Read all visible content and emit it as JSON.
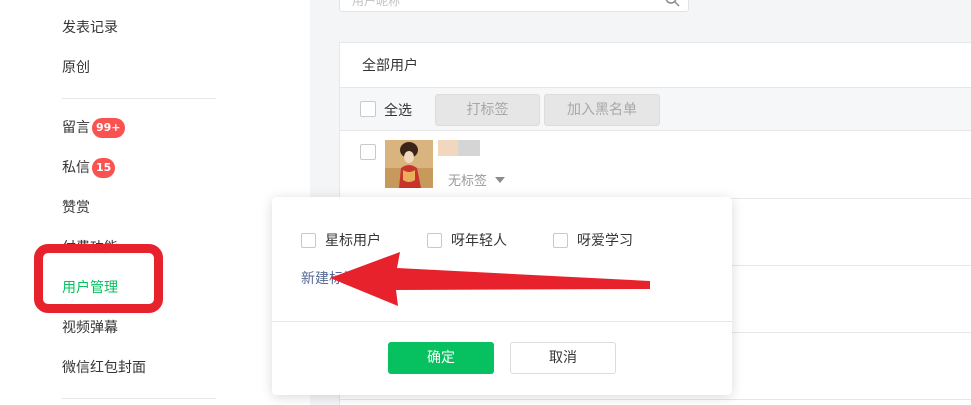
{
  "sidebar": {
    "items": [
      {
        "label": "发表记录"
      },
      {
        "label": "原创"
      },
      {
        "label": "留言",
        "badge": "99+"
      },
      {
        "label": "私信",
        "badge": "15"
      },
      {
        "label": "赞赏"
      },
      {
        "label": "付费功能"
      },
      {
        "label": "用户管理"
      },
      {
        "label": "视频弹幕"
      },
      {
        "label": "微信红包封面"
      }
    ]
  },
  "search": {
    "placeholder": "用户昵称"
  },
  "panel": {
    "title": "全部用户",
    "select_all_label": "全选",
    "tag_button": "打标签",
    "blacklist_button": "加入黑名单",
    "user": {
      "tag_label": "无标签"
    }
  },
  "popover": {
    "tags": [
      {
        "label": "星标用户"
      },
      {
        "label": "呀年轻人"
      },
      {
        "label": "呀爱学习"
      }
    ],
    "new_tag_label": "新建标签",
    "confirm_label": "确定",
    "cancel_label": "取消"
  },
  "colors": {
    "accent": "#07c160",
    "badge": "#fa5151",
    "annotation": "#e7222c",
    "link": "#576b95"
  }
}
